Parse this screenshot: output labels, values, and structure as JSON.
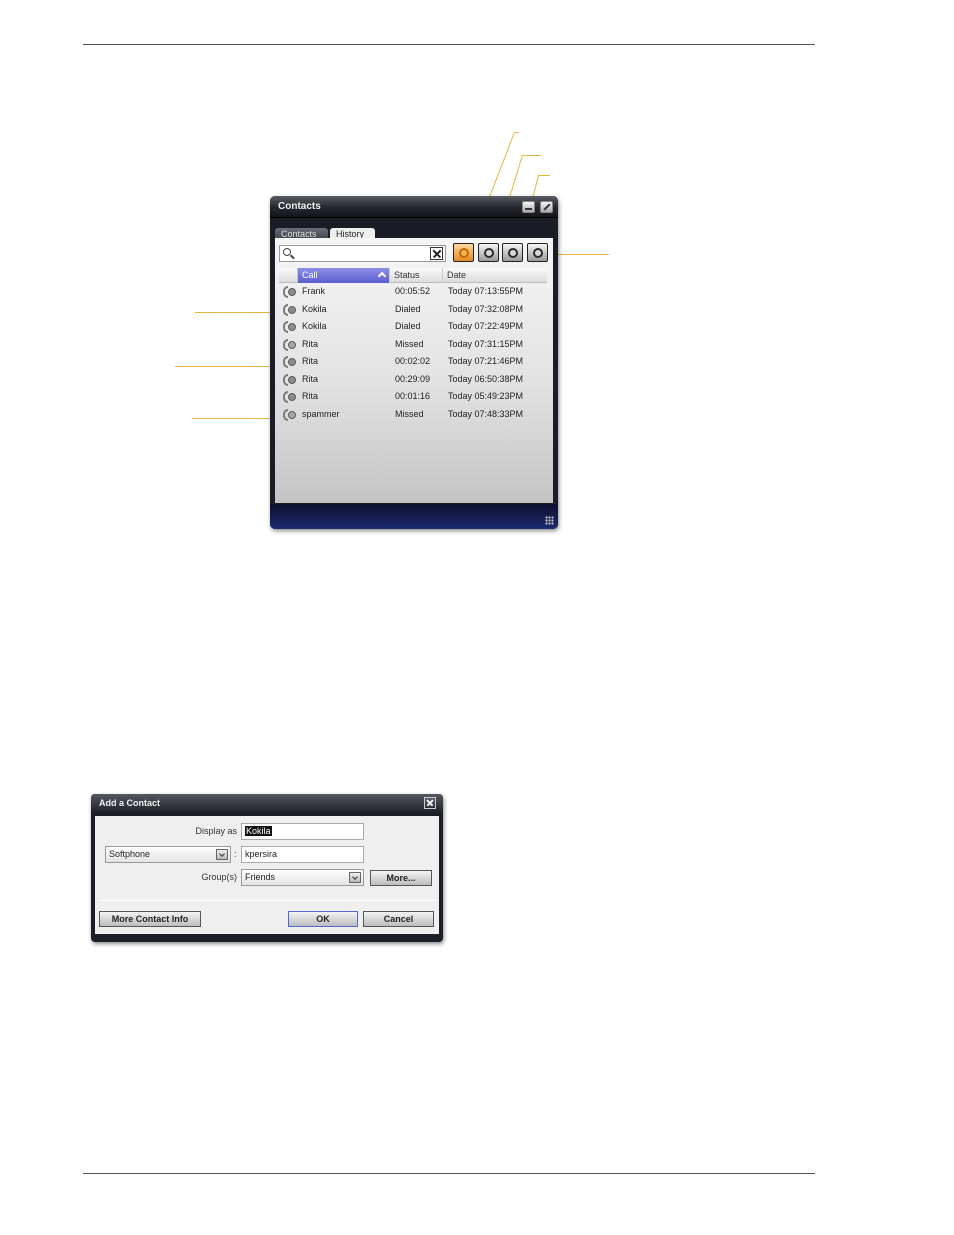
{
  "contacts_window": {
    "title": "Contacts",
    "tabs": [
      {
        "label": "Contacts",
        "active": false
      },
      {
        "label": "History",
        "active": true
      }
    ],
    "search": {
      "value": "",
      "placeholder": ""
    },
    "filter_buttons": [
      "all-calls-icon",
      "dialed-calls-icon",
      "missed-calls-icon",
      "received-calls-icon"
    ],
    "columns": {
      "icon": "",
      "call": "Call",
      "status": "Status",
      "date": "Date"
    },
    "rows": [
      {
        "type": "received",
        "name": "Frank",
        "status": "00:05:52",
        "date": "Today 07:13:55PM"
      },
      {
        "type": "dialed",
        "name": "Kokila",
        "status": "Dialed",
        "date": "Today 07:32:08PM"
      },
      {
        "type": "dialed",
        "name": "Kokila",
        "status": "Dialed",
        "date": "Today 07:22:49PM"
      },
      {
        "type": "missed",
        "name": "Rita",
        "status": "Missed",
        "date": "Today 07:31:15PM"
      },
      {
        "type": "received",
        "name": "Rita",
        "status": "00:02:02",
        "date": "Today 07:21:46PM"
      },
      {
        "type": "received",
        "name": "Rita",
        "status": "00:29:09",
        "date": "Today 06:50:38PM"
      },
      {
        "type": "received",
        "name": "Rita",
        "status": "00:01:16",
        "date": "Today 05:49:23PM"
      },
      {
        "type": "missed",
        "name": "spammer",
        "status": "Missed",
        "date": "Today 07:48:33PM"
      }
    ]
  },
  "add_contact_dialog": {
    "title": "Add a Contact",
    "display_as_label": "Display as",
    "display_as_value": "Kokila",
    "account_type": "Softphone",
    "address_separator": ":",
    "address_value": "kpersira",
    "groups_label": "Group(s)",
    "groups_value": "Friends",
    "more_button": "More...",
    "more_contact_info_button": "More Contact Info",
    "ok_button": "OK",
    "cancel_button": "Cancel"
  },
  "colors": {
    "callout_line": "#e8b640",
    "active_filter": "#e58a1e",
    "sorted_header": "#5d5dd2",
    "window_chrome": "#1b1d26"
  }
}
